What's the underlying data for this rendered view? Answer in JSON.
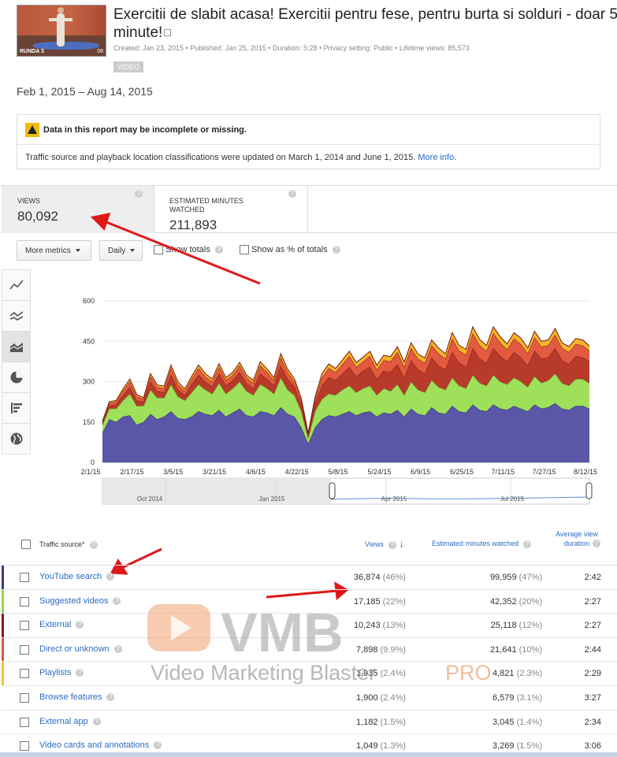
{
  "video": {
    "thumb_label": "RUNDA 3",
    "thumb_duration": "08",
    "title": "Exercitii de slabit acasa! Exercitii pentru fese, pentru burta si solduri - doar 5 minute!",
    "meta": "Created: Jan 23, 2015  •  Published: Jan 25, 2015  •  Duration: 5:28  •  Privacy setting: Public  •  Lifetime views: 85,573",
    "badge": "VIDEO"
  },
  "date_range": "Feb 1, 2015 – Aug 14, 2015",
  "notice": {
    "warning": "Data in this report may be incomplete or missing.",
    "info": "Traffic source and playback location classifications were updated on March 1, 2014 and June 1, 2015.",
    "link": "More info",
    "tail": "."
  },
  "metrics": [
    {
      "label": "VIEWS",
      "value": "80,092"
    },
    {
      "label": "ESTIMATED MINUTES WATCHED",
      "value": "211,893"
    }
  ],
  "controls": {
    "more_metrics": "More metrics",
    "daily": "Daily",
    "show_totals": "Show totals",
    "show_pct": "Show as % of totals"
  },
  "chart_data": {
    "type": "area",
    "stacked": true,
    "ylim": [
      0,
      600
    ],
    "yticks": [
      "0",
      "150",
      "300",
      "450",
      "600"
    ],
    "xticks": [
      "2/1/15",
      "2/17/15",
      "3/5/15",
      "3/21/15",
      "4/6/15",
      "4/22/15",
      "5/8/15",
      "5/24/15",
      "6/9/15",
      "6/25/15",
      "7/11/15",
      "7/27/15",
      "8/12/15"
    ],
    "timeline_labels": [
      "Oct 2014",
      "Jan 2015",
      "Apr 2015",
      "Jul 2015"
    ],
    "series": [
      {
        "color": "#5a56a8",
        "values": [
          110,
          160,
          150,
          170,
          175,
          140,
          150,
          180,
          160,
          170,
          190,
          165,
          160,
          170,
          190,
          180,
          175,
          195,
          170,
          185,
          200,
          175,
          170,
          190,
          185,
          175,
          205,
          180,
          170,
          130,
          70,
          130,
          160,
          175,
          170,
          180,
          190,
          175,
          185,
          190,
          170,
          185,
          180,
          195,
          170,
          200,
          180,
          175,
          205,
          185,
          180,
          210,
          190,
          185,
          215,
          195,
          190,
          215,
          200,
          195,
          210,
          200,
          190,
          215,
          200,
          205,
          220,
          200,
          195,
          210,
          210,
          200
        ]
      },
      {
        "color": "#9ee05a",
        "values": [
          30,
          40,
          50,
          60,
          80,
          70,
          60,
          90,
          80,
          70,
          100,
          80,
          70,
          90,
          100,
          90,
          80,
          100,
          85,
          90,
          100,
          90,
          80,
          100,
          90,
          80,
          110,
          90,
          80,
          60,
          20,
          60,
          75,
          80,
          80,
          90,
          95,
          85,
          90,
          95,
          80,
          90,
          85,
          95,
          80,
          100,
          90,
          85,
          100,
          95,
          90,
          105,
          95,
          90,
          110,
          100,
          95,
          110,
          100,
          95,
          105,
          100,
          90,
          105,
          95,
          100,
          110,
          95,
          90,
          100,
          100,
          95
        ]
      },
      {
        "color": "#b83a2a",
        "values": [
          5,
          10,
          15,
          20,
          25,
          20,
          15,
          30,
          25,
          20,
          35,
          25,
          20,
          30,
          35,
          30,
          25,
          35,
          30,
          30,
          35,
          30,
          25,
          40,
          35,
          30,
          45,
          40,
          30,
          25,
          10,
          30,
          50,
          60,
          55,
          60,
          70,
          60,
          65,
          70,
          60,
          65,
          70,
          75,
          65,
          80,
          75,
          70,
          85,
          80,
          75,
          95,
          85,
          80,
          100,
          90,
          85,
          100,
          95,
          85,
          95,
          90,
          80,
          95,
          90,
          85,
          95,
          85,
          80,
          85,
          80,
          80
        ]
      },
      {
        "color": "#e25a40",
        "values": [
          5,
          10,
          10,
          15,
          20,
          15,
          10,
          20,
          15,
          15,
          25,
          20,
          15,
          20,
          25,
          20,
          20,
          25,
          20,
          20,
          25,
          20,
          20,
          30,
          25,
          20,
          30,
          25,
          20,
          15,
          5,
          15,
          30,
          35,
          30,
          35,
          40,
          35,
          35,
          40,
          35,
          40,
          40,
          45,
          40,
          45,
          40,
          40,
          45,
          45,
          40,
          50,
          45,
          45,
          55,
          50,
          45,
          55,
          50,
          45,
          50,
          50,
          45,
          50,
          45,
          45,
          50,
          45,
          45,
          45,
          45,
          40
        ]
      },
      {
        "color": "#f5b42a",
        "values": [
          3,
          5,
          5,
          8,
          10,
          8,
          5,
          10,
          8,
          8,
          12,
          10,
          8,
          10,
          12,
          10,
          10,
          12,
          10,
          10,
          12,
          10,
          10,
          14,
          12,
          10,
          14,
          12,
          10,
          8,
          3,
          8,
          14,
          16,
          14,
          16,
          18,
          16,
          16,
          18,
          16,
          18,
          18,
          20,
          18,
          20,
          18,
          18,
          20,
          20,
          18,
          22,
          20,
          20,
          24,
          22,
          20,
          24,
          22,
          20,
          22,
          22,
          20,
          22,
          20,
          20,
          22,
          20,
          20,
          20,
          20,
          18
        ]
      }
    ]
  },
  "table": {
    "headers": {
      "source": "Traffic source*",
      "views": "Views",
      "minutes": "Estimated minutes watched",
      "avg": "Average view duration"
    },
    "rows": [
      {
        "source": "YouTube search",
        "views": "36,874",
        "views_pct": "(46%)",
        "minutes": "99,959",
        "minutes_pct": "(47%)",
        "avg": "2:42",
        "color": "#3c3a8c"
      },
      {
        "source": "Suggested videos",
        "views": "17,185",
        "views_pct": "(22%)",
        "minutes": "42,352",
        "minutes_pct": "(20%)",
        "avg": "2:27",
        "color": "#8fd84a"
      },
      {
        "source": "External",
        "views": "10,243",
        "views_pct": "(13%)",
        "minutes": "25,118",
        "minutes_pct": "(12%)",
        "avg": "2:27",
        "color": "#8b1b12"
      },
      {
        "source": "Direct or unknown",
        "views": "7,898",
        "views_pct": "(9.9%)",
        "minutes": "21,641",
        "minutes_pct": "(10%)",
        "avg": "2:44",
        "color": "#d9553a"
      },
      {
        "source": "Playlists",
        "views": "1,935",
        "views_pct": "(2.4%)",
        "minutes": "4,821",
        "minutes_pct": "(2.3%)",
        "avg": "2:29",
        "color": "#f2c22e"
      },
      {
        "source": "Browse features",
        "views": "1,900",
        "views_pct": "(2.4%)",
        "minutes": "6,579",
        "minutes_pct": "(3.1%)",
        "avg": "3:27",
        "color": "#ffffff"
      },
      {
        "source": "External app",
        "views": "1,182",
        "views_pct": "(1.5%)",
        "minutes": "3,045",
        "minutes_pct": "(1.4%)",
        "avg": "2:34",
        "color": "#ffffff"
      },
      {
        "source": "Video cards and annotations",
        "views": "1,049",
        "views_pct": "(1.3%)",
        "minutes": "3,269",
        "minutes_pct": "(1.5%)",
        "avg": "3:06",
        "color": "#ffffff"
      }
    ]
  },
  "watermark": {
    "brand": "VMB",
    "tagline": "Video Marketing Blaster",
    "suffix": "PRO"
  },
  "colors": {
    "link": "#2b6cc4",
    "annotation_arrow": "#e01818"
  }
}
